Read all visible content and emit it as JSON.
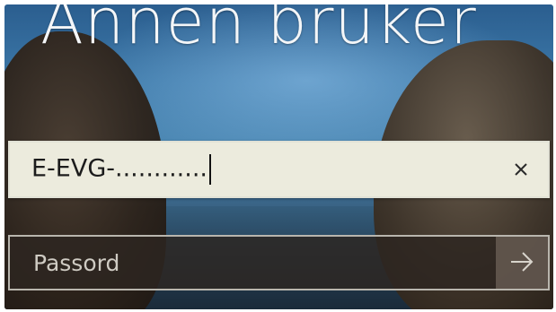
{
  "login": {
    "title": "Annen bruker",
    "username": {
      "value": "E-EVG-............",
      "clear_icon": "close-icon"
    },
    "password": {
      "placeholder": "Passord",
      "submit_icon": "arrow-right-icon"
    }
  },
  "colors": {
    "title_text": "#f4f6f8",
    "user_field_bg": "#ecebdd",
    "password_field_bg": "#2d2621",
    "password_field_border": "#b9b6ae"
  }
}
